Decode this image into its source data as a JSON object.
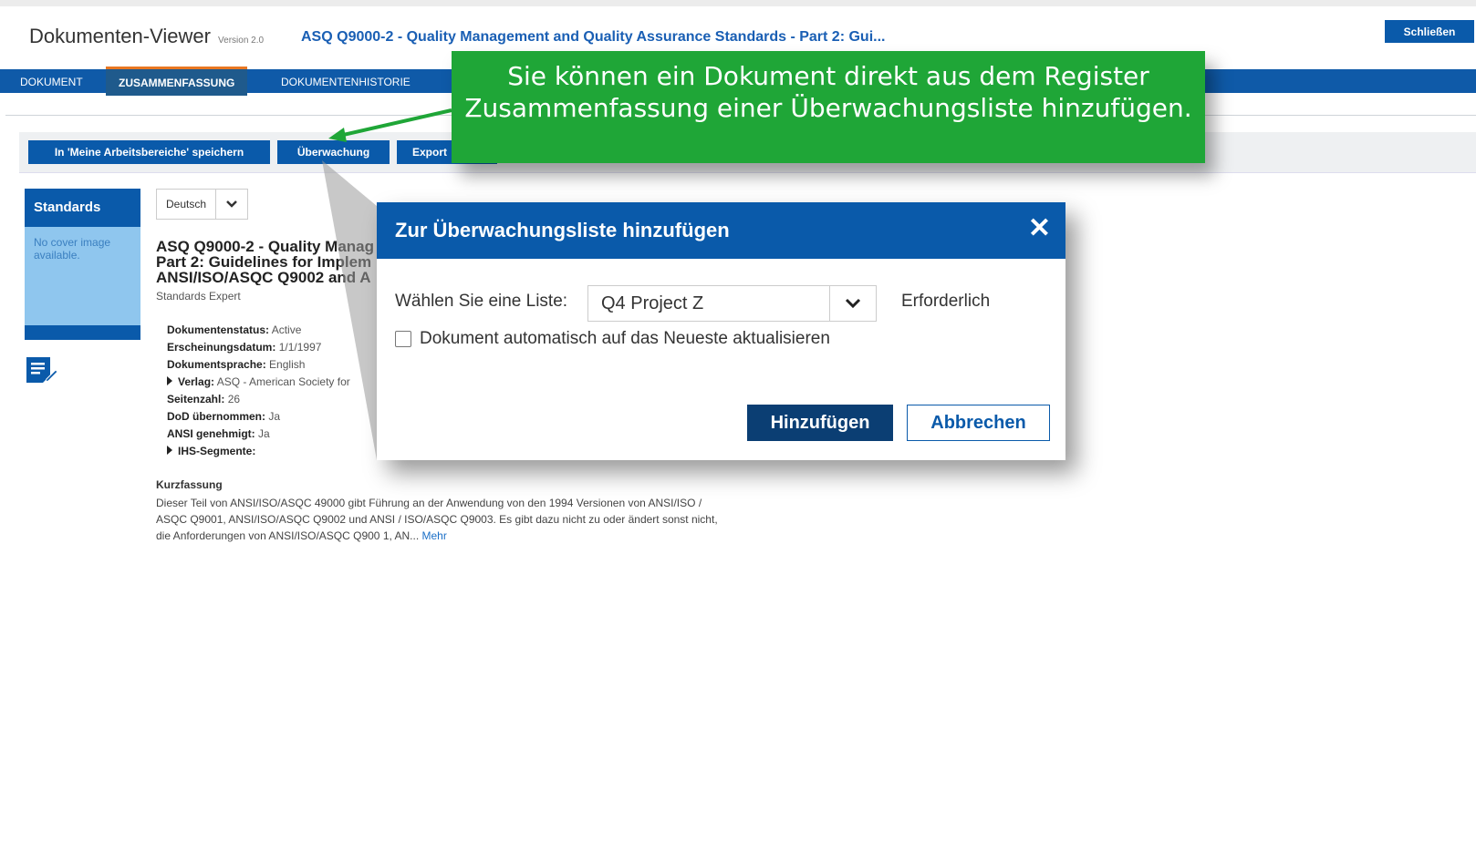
{
  "header": {
    "app_title": "Dokumenten-Viewer",
    "version": "Version 2.0",
    "document_title": "ASQ Q9000-2 - Quality Management and Quality Assurance Standards - Part 2: Gui...",
    "close_label": "Schließen"
  },
  "tabs": [
    {
      "label": "DOKUMENT"
    },
    {
      "label": "ZUSAMMENFASSUNG"
    },
    {
      "label": "DOKUMENTENHISTORIE"
    }
  ],
  "actions": {
    "save_workspace": "In 'Meine Arbeitsbereiche' speichern",
    "monitoring": "Überwachung",
    "export": "Export"
  },
  "sidebar": {
    "heading": "Standards",
    "cover_text": "No cover image available."
  },
  "document": {
    "language": "Deutsch",
    "heading_lines": [
      "ASQ Q9000-2 - Quality Manag",
      "Part 2: Guidelines for Implem",
      "ANSI/ISO/ASQC Q9002 and A"
    ],
    "publisher": "Standards Expert",
    "meta": [
      {
        "label": "Dokumentenstatus:",
        "value": "Active",
        "expandable": false
      },
      {
        "label": "Erscheinungsdatum:",
        "value": "1/1/1997",
        "expandable": false
      },
      {
        "label": "Dokumentsprache:",
        "value": "English",
        "expandable": false
      },
      {
        "label": "Verlag:",
        "value": "ASQ - American Society for",
        "expandable": true
      },
      {
        "label": "Seitenzahl:",
        "value": "26",
        "expandable": false
      },
      {
        "label": "DoD übernommen:",
        "value": "Ja",
        "expandable": false
      },
      {
        "label": "ANSI genehmigt:",
        "value": "Ja",
        "expandable": false
      },
      {
        "label": "IHS-Segmente:",
        "value": "",
        "expandable": true
      }
    ],
    "abstract_heading": "Kurzfassung",
    "abstract_text": "Dieser Teil von ANSI/ISO/ASQC 49000 gibt Führung an der Anwendung von den 1994 Versionen von ANSI/ISO / ASQC Q9001, ANSI/ISO/ASQC Q9002 und ANSI / ISO/ASQC Q9003. Es gibt dazu nicht zu oder ändert sonst nicht, die Anforderungen von ANSI/ISO/ASQC Q900 1, AN...",
    "more_link": "Mehr"
  },
  "callout": {
    "text": "Sie können ein Dokument direkt aus dem Register Zusammenfassung einer Überwachungsliste hinzufügen.",
    "color": "#1fa637"
  },
  "modal": {
    "title": "Zur Überwachungsliste hinzufügen",
    "close_glyph": "✕",
    "list_label": "Wählen Sie eine Liste:",
    "list_value": "Q4 Project Z",
    "required_label": "Erforderlich",
    "auto_update_label": "Dokument automatisch auf das Neueste aktualisieren",
    "auto_update_checked": false,
    "add_label": "Hinzufügen",
    "cancel_label": "Abbrechen"
  },
  "colors": {
    "primary": "#0a5aaa",
    "active_tab_accent": "#e87722",
    "add_button": "#0b3e73"
  }
}
